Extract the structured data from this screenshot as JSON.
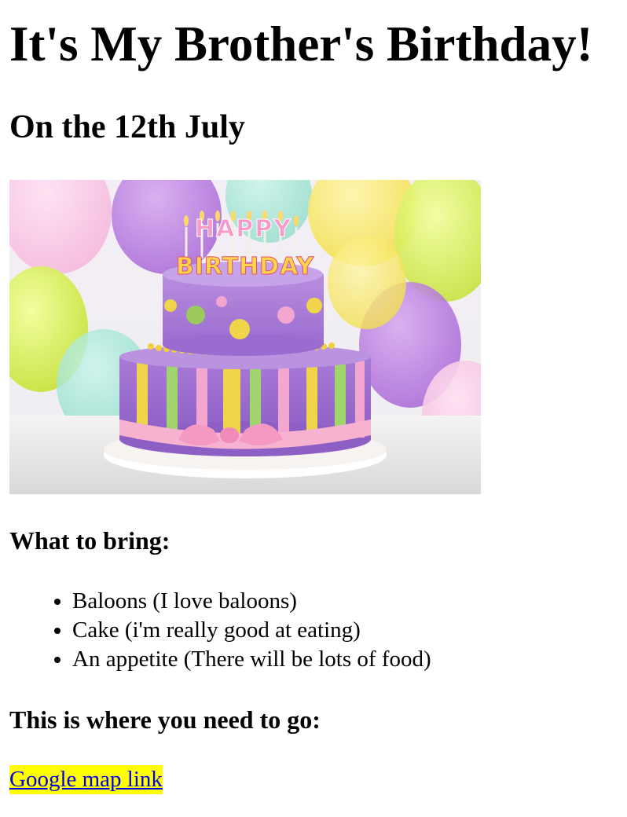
{
  "page": {
    "heading": "It's My Brother's Birthday!",
    "subheading": "On the 12th July",
    "image": {
      "banner_top": "HAPPY",
      "banner_bottom": "BIRTHDAY"
    },
    "bring_heading": "What to bring:",
    "bring_items": [
      "Baloons (I love baloons)",
      "Cake (i'm really good at eating)",
      "An appetite (There will be lots of food)"
    ],
    "where_heading": "This is where you need to go:",
    "map_link_label": "Google map link"
  },
  "colors": {
    "link": "#0000ee",
    "link_highlight": "#ffff00"
  }
}
